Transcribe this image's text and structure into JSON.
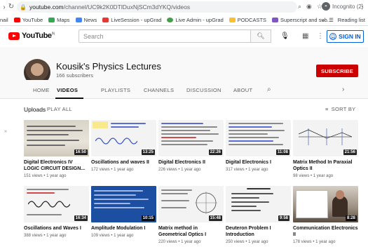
{
  "browser": {
    "url_host": "youtube.com",
    "url_path": "/channel/UC9k2K0DTlDuxNjSCm3dYKQ/videos",
    "profile_label": "Incognito (2)",
    "bookmarks": [
      {
        "label": "nail",
        "color": "#ffffff"
      },
      {
        "label": "YouTube",
        "color": "#ff0000"
      },
      {
        "label": "Maps",
        "color": "#34a853"
      },
      {
        "label": "News",
        "color": "#4285f4"
      },
      {
        "label": "LiveSession - upGrad",
        "color": "#e53935"
      },
      {
        "label": "Live Admin - upGrad",
        "color": "#43a047"
      },
      {
        "label": "PODCASTS",
        "color": "#fbc02d"
      },
      {
        "label": "Superscript and sub...",
        "color": "#7e57c2"
      }
    ],
    "bookmarks_overflow": "»",
    "reading_list": "Reading list"
  },
  "youtube": {
    "logo_text": "YouTube",
    "logo_region": "IN",
    "search_placeholder": "Search",
    "signin_label": "SIGN IN",
    "accent": "#ff0000",
    "link_blue": "#065fd4"
  },
  "channel": {
    "name": "Kousik's Physics Lectures",
    "subscribers": "166 subscribers",
    "subscribe_label": "SUBSCRIBE",
    "tabs": [
      {
        "label": "HOME",
        "active": false
      },
      {
        "label": "VIDEOS",
        "active": true
      },
      {
        "label": "PLAYLISTS",
        "active": false
      },
      {
        "label": "CHANNELS",
        "active": false
      },
      {
        "label": "DISCUSSION",
        "active": false
      },
      {
        "label": "ABOUT",
        "active": false
      }
    ]
  },
  "uploads": {
    "title": "Uploads",
    "play_all": "PLAY ALL",
    "sort_by": "SORT BY"
  },
  "videos": [
    {
      "title": "Digital Electronics IV LOGIC CIRCUIT DESIGN...",
      "meta": "151 views • 1 year ago",
      "duration": "16:50",
      "thumb": "paper"
    },
    {
      "title": "Oscillations and waves II",
      "meta": "172 views • 1 year ago",
      "duration": "13:25",
      "thumb": "white-wave"
    },
    {
      "title": "Digital Electronics II",
      "meta": "226 views • 1 year ago",
      "duration": "22:26",
      "thumb": "white-lines"
    },
    {
      "title": "Digital Electronics I",
      "meta": "317 views • 1 year ago",
      "duration": "11:08",
      "thumb": "white-lines"
    },
    {
      "title": "Matrix Method In Paraxial Optics II",
      "meta": "98 views • 1 year ago",
      "duration": "21:56",
      "thumb": "white-diagram"
    },
    {
      "title": "Oscillations and Waves I",
      "meta": "388 views • 1 year ago",
      "duration": "16:34",
      "thumb": "white-wave"
    },
    {
      "title": "Amplitude Modulation I",
      "meta": "109 views • 1 year ago",
      "duration": "10:15",
      "thumb": "blue"
    },
    {
      "title": "Matrix method in Geometrical Optics I",
      "meta": "220 views • 1 year ago",
      "duration": "15:48",
      "thumb": "white-lines"
    },
    {
      "title": "Deuteron Problem I Introduction",
      "meta": "250 views • 1 year ago",
      "duration": "9:58",
      "thumb": "slide"
    },
    {
      "title": "Communication Electronics II",
      "meta": "178 views • 1 year ago",
      "duration": "8:28",
      "thumb": "room"
    }
  ]
}
